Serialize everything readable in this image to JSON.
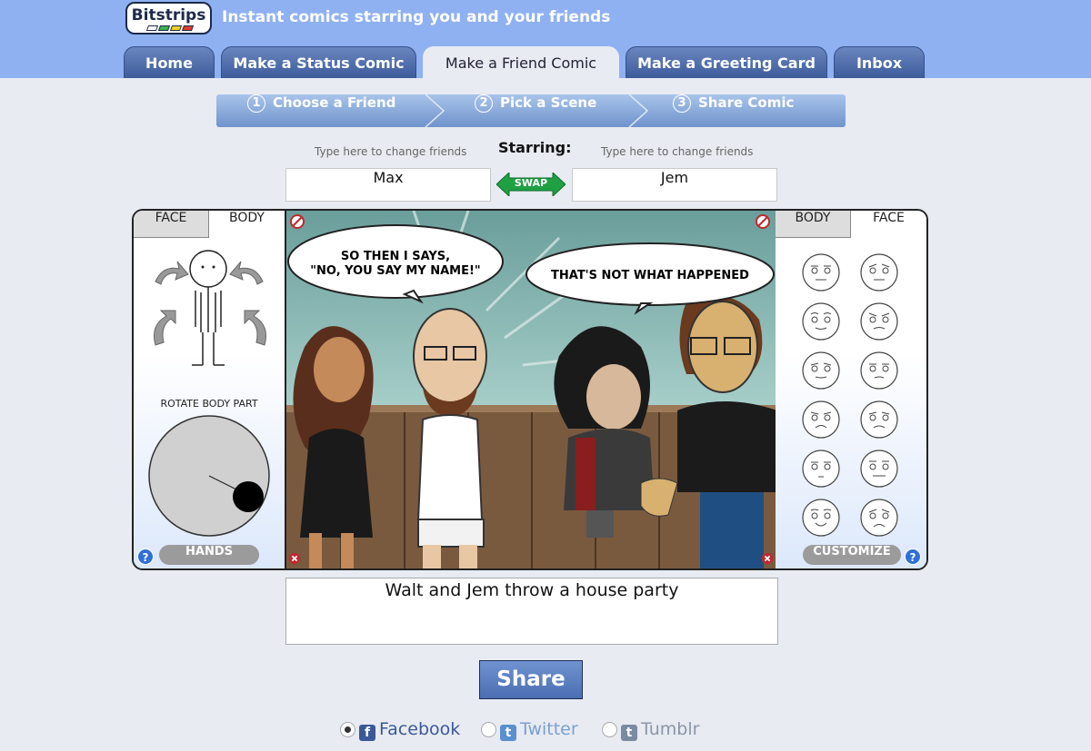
{
  "header": {
    "logo_text": "Bitstrips",
    "tagline": "Instant comics starring you and your friends",
    "tabs": [
      {
        "label": "Home"
      },
      {
        "label": "Make a Status Comic"
      },
      {
        "label": "Make a Friend Comic"
      },
      {
        "label": "Make a Greeting Card"
      },
      {
        "label": "Inbox"
      }
    ],
    "active_tab": "Make a Friend Comic"
  },
  "steps": [
    {
      "num": "1",
      "label": "Choose a Friend"
    },
    {
      "num": "2",
      "label": "Pick a Scene"
    },
    {
      "num": "3",
      "label": "Share Comic"
    }
  ],
  "starring": {
    "label": "Starring:",
    "left_hint": "Type here to change friends",
    "right_hint": "Type here to change friends",
    "left_name": "Max",
    "right_name": "Jem",
    "swap_label": "SWAP"
  },
  "left_panel": {
    "tabs": [
      "FACE",
      "BODY"
    ],
    "active_tab": "BODY",
    "rotate_label": "ROTATE BODY PART",
    "hands_label": "HANDS",
    "help": "?"
  },
  "right_panel": {
    "tabs": [
      "BODY",
      "FACE"
    ],
    "active_tab": "FACE",
    "customize_label": "CUSTOMIZE",
    "help": "?"
  },
  "comic": {
    "bubble_left": [
      "SO THEN I SAYS,",
      "\"NO, YOU SAY MY NAME!\""
    ],
    "bubble_right": "THAT'S NOT WHAT HAPPENED"
  },
  "caption": "Walt and Jem throw a house party",
  "share_label": "Share",
  "social": [
    {
      "label": "Facebook",
      "selected": true,
      "icon": "f",
      "color": "#3b5998"
    },
    {
      "label": "Twitter",
      "selected": false,
      "icon": "t",
      "color": "#5a8fd0"
    },
    {
      "label": "Tumblr",
      "selected": false,
      "icon": "t",
      "color": "#7a8aa0"
    }
  ],
  "colors": {
    "header_bg": "#8fb1f2",
    "tab_bg": "#4a6aa8",
    "page_bg": "#e8ebf2",
    "swap_green": "#1fa043"
  }
}
